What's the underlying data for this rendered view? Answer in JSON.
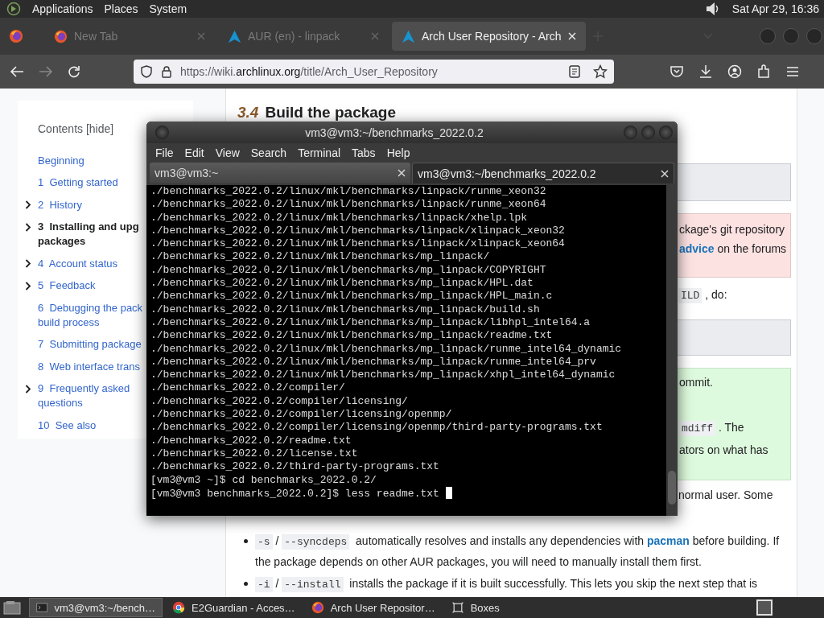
{
  "top_panel": {
    "menus": [
      "Applications",
      "Places",
      "System"
    ],
    "clock": "Sat Apr 29, 16:36"
  },
  "browser": {
    "tabs": [
      {
        "title": "New Tab",
        "selected": false
      },
      {
        "title": "AUR (en) - linpack",
        "selected": false
      },
      {
        "title": "Arch User Repository - Arch",
        "selected": true
      }
    ],
    "url": {
      "prefix": "https://wiki.",
      "domain": "archlinux.org",
      "path": "/title/Arch_User_Repository"
    }
  },
  "page": {
    "toc": {
      "title": "Contents",
      "bracket_open": "[",
      "toggle": "hide",
      "bracket_close": "]",
      "items": [
        {
          "lines": [
            "Beginning"
          ],
          "expandable": false,
          "selected": false
        },
        {
          "number": "1",
          "lines": [
            "Getting started"
          ],
          "expandable": false,
          "selected": false
        },
        {
          "number": "2",
          "lines": [
            "History"
          ],
          "expandable": true,
          "selected": false
        },
        {
          "number": "3",
          "lines": [
            "Installing and upg",
            "packages"
          ],
          "expandable": true,
          "selected": true
        },
        {
          "number": "4",
          "lines": [
            "Account status"
          ],
          "expandable": true,
          "selected": false
        },
        {
          "number": "5",
          "lines": [
            "Feedback"
          ],
          "expandable": true,
          "selected": false
        },
        {
          "number": "6",
          "lines": [
            "Debugging the pack",
            "build process"
          ],
          "expandable": false,
          "selected": false
        },
        {
          "number": "7",
          "lines": [
            "Submitting package"
          ],
          "expandable": false,
          "selected": false
        },
        {
          "number": "8",
          "lines": [
            "Web interface trans"
          ],
          "expandable": false,
          "selected": false
        },
        {
          "number": "9",
          "lines": [
            "Frequently asked",
            "questions"
          ],
          "expandable": true,
          "selected": false
        },
        {
          "number": "10",
          "lines": [
            "See also"
          ],
          "expandable": false,
          "selected": false
        }
      ]
    },
    "section": {
      "number": "3.4",
      "title": "Build the package"
    },
    "blocks": [
      {
        "kind": "code_box"
      },
      {
        "kind": "warning",
        "lines": [
          {
            "text": "ckage's git repository"
          },
          {
            "link": "advice",
            "text": " on the forums"
          }
        ]
      },
      {
        "kind": "text",
        "lines": [
          {
            "code": "ILD",
            "text": ", do:"
          }
        ]
      },
      {
        "kind": "code_box"
      },
      {
        "kind": "tip",
        "lines": [
          {
            "text": "ommit."
          },
          {
            "code": "mdiff",
            "text": ". The"
          },
          {
            "text": "ators on what has"
          }
        ]
      },
      {
        "kind": "text",
        "lines": [
          {
            "text": "normal user. Some"
          }
        ]
      }
    ],
    "bullets": [
      {
        "options": [
          "-s",
          "--syncdeps"
        ],
        "separator": "/",
        "before": "automatically resolves and installs any dependencies with",
        "link": "pacman",
        "after": "before building. If the package depends on other AUR packages, you will need to manually install them first."
      },
      {
        "options": [
          "-i",
          "--install"
        ],
        "separator": "/",
        "before": "installs the package if it is built successfully. This lets you skip the next step that is"
      }
    ]
  },
  "terminal": {
    "title": "vm3@vm3:~/benchmarks_2022.0.2",
    "menus": [
      "File",
      "Edit",
      "View",
      "Search",
      "Terminal",
      "Tabs",
      "Help"
    ],
    "tabs": [
      {
        "title": "vm3@vm3:~",
        "selected": false
      },
      {
        "title": "vm3@vm3:~/benchmarks_2022.0.2",
        "selected": true
      }
    ],
    "lines": [
      "./benchmarks_2022.0.2/linux/mkl/benchmarks/linpack/runme_xeon32",
      "./benchmarks_2022.0.2/linux/mkl/benchmarks/linpack/runme_xeon64",
      "./benchmarks_2022.0.2/linux/mkl/benchmarks/linpack/xhelp.lpk",
      "./benchmarks_2022.0.2/linux/mkl/benchmarks/linpack/xlinpack_xeon32",
      "./benchmarks_2022.0.2/linux/mkl/benchmarks/linpack/xlinpack_xeon64",
      "./benchmarks_2022.0.2/linux/mkl/benchmarks/mp_linpack/",
      "./benchmarks_2022.0.2/linux/mkl/benchmarks/mp_linpack/COPYRIGHT",
      "./benchmarks_2022.0.2/linux/mkl/benchmarks/mp_linpack/HPL.dat",
      "./benchmarks_2022.0.2/linux/mkl/benchmarks/mp_linpack/HPL_main.c",
      "./benchmarks_2022.0.2/linux/mkl/benchmarks/mp_linpack/build.sh",
      "./benchmarks_2022.0.2/linux/mkl/benchmarks/mp_linpack/libhpl_intel64.a",
      "./benchmarks_2022.0.2/linux/mkl/benchmarks/mp_linpack/readme.txt",
      "./benchmarks_2022.0.2/linux/mkl/benchmarks/mp_linpack/runme_intel64_dynamic",
      "./benchmarks_2022.0.2/linux/mkl/benchmarks/mp_linpack/runme_intel64_prv",
      "./benchmarks_2022.0.2/linux/mkl/benchmarks/mp_linpack/xhpl_intel64_dynamic",
      "./benchmarks_2022.0.2/compiler/",
      "./benchmarks_2022.0.2/compiler/licensing/",
      "./benchmarks_2022.0.2/compiler/licensing/openmp/",
      "./benchmarks_2022.0.2/compiler/licensing/openmp/third-party-programs.txt",
      "./benchmarks_2022.0.2/readme.txt",
      "./benchmarks_2022.0.2/license.txt",
      "./benchmarks_2022.0.2/third-party-programs.txt",
      "[vm3@vm3 ~]$ cd benchmarks_2022.0.2/",
      "[vm3@vm3 benchmarks_2022.0.2]$ less readme.txt"
    ]
  },
  "taskbar": {
    "items": [
      {
        "title": "vm3@vm3:~/bench…",
        "selected": true
      },
      {
        "title": "E2Guardian - Acces…",
        "selected": false
      },
      {
        "title": "Arch User Repositor…",
        "selected": false
      },
      {
        "title": "Boxes",
        "selected": false
      }
    ]
  }
}
